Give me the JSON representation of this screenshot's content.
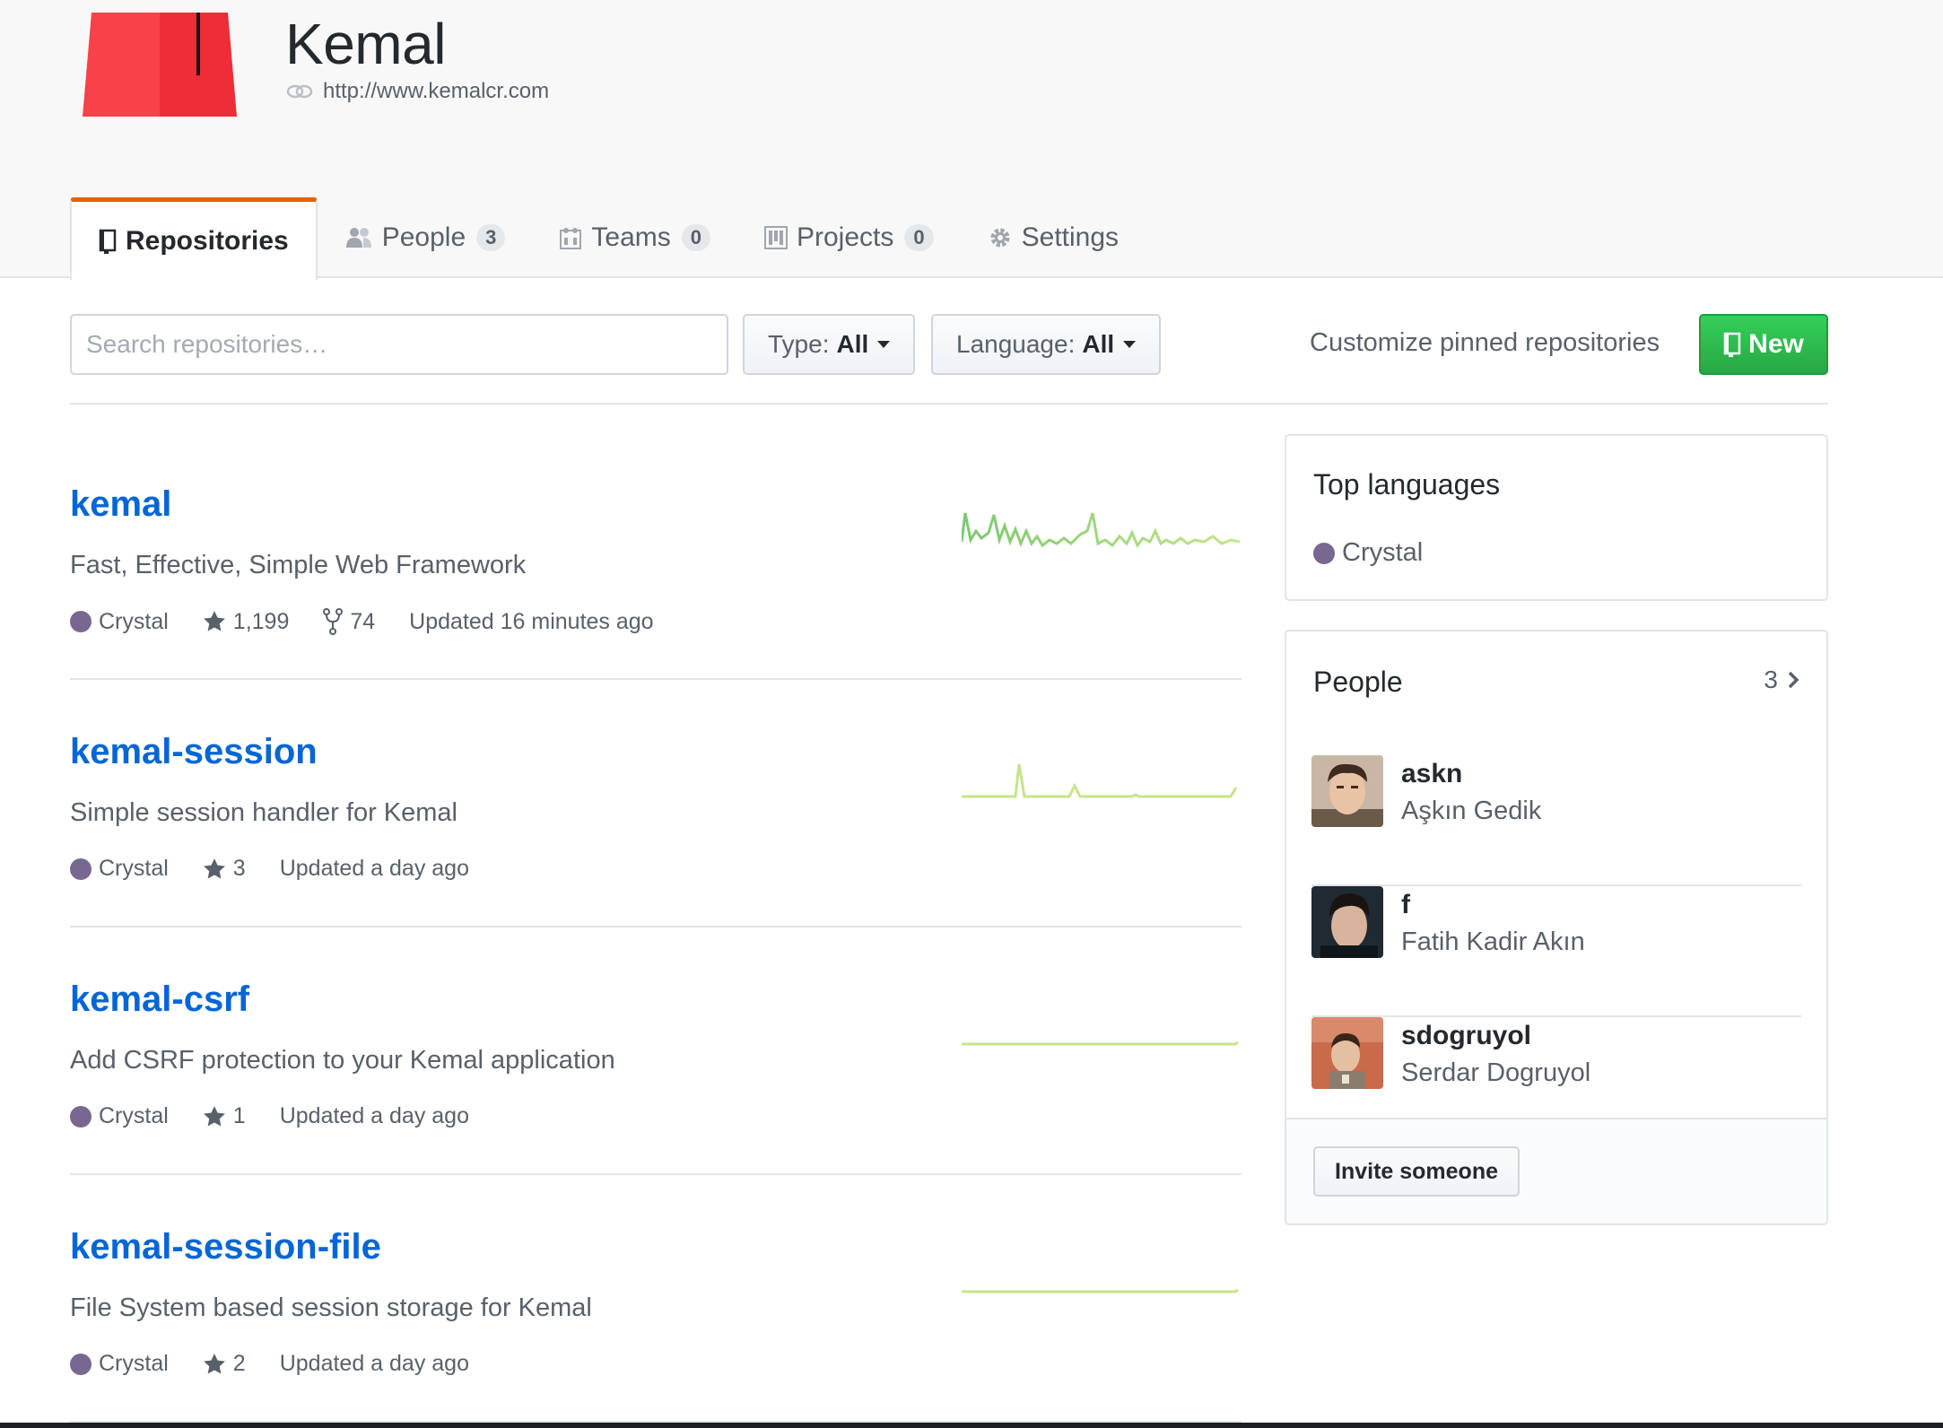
{
  "org": {
    "name": "Kemal",
    "url": "http://www.kemalcr.com",
    "logo_colors": {
      "left": "#f94149",
      "right": "#ee2d37",
      "bar": "#111111"
    }
  },
  "tabs": [
    {
      "label": "Repositories",
      "icon": "repo-icon",
      "selected": true
    },
    {
      "label": "People",
      "icon": "people-icon",
      "count": "3"
    },
    {
      "label": "Teams",
      "icon": "teams-icon",
      "count": "0"
    },
    {
      "label": "Projects",
      "icon": "projects-icon",
      "count": "0"
    },
    {
      "label": "Settings",
      "icon": "gear-icon"
    }
  ],
  "toolbar": {
    "search_placeholder": "Search repositories…",
    "type_label": "Type:",
    "type_value": "All",
    "language_label": "Language:",
    "language_value": "All",
    "customize_label": "Customize pinned repositories",
    "new_label": "New"
  },
  "repos": [
    {
      "name": "kemal",
      "description": "Fast, Effective, Simple Web Framework",
      "language": "Crystal",
      "stars": "1,199",
      "forks": "74",
      "updated": "Updated 16 minutes ago"
    },
    {
      "name": "kemal-session",
      "description": "Simple session handler for Kemal",
      "language": "Crystal",
      "stars": "3",
      "updated": "Updated a day ago"
    },
    {
      "name": "kemal-csrf",
      "description": "Add CSRF protection to your Kemal application",
      "language": "Crystal",
      "stars": "1",
      "updated": "Updated a day ago"
    },
    {
      "name": "kemal-session-file",
      "description": "File System based session storage for Kemal",
      "language": "Crystal",
      "stars": "2",
      "updated": "Updated a day ago"
    }
  ],
  "sidebar": {
    "top_languages": {
      "title": "Top languages",
      "languages": [
        {
          "name": "Crystal",
          "color": "#776791"
        }
      ]
    },
    "people": {
      "title": "People",
      "count": "3",
      "members": [
        {
          "login": "askn",
          "name": "Aşkın Gedik"
        },
        {
          "login": "f",
          "name": "Fatih Kadir Akın"
        },
        {
          "login": "sdogruyol",
          "name": "Serdar Dogruyol"
        }
      ],
      "invite_label": "Invite someone"
    }
  },
  "colors": {
    "accent_tab": "#e36209",
    "link": "#0366d6",
    "new_button": "#2cbe4e",
    "crystal": "#776791"
  }
}
